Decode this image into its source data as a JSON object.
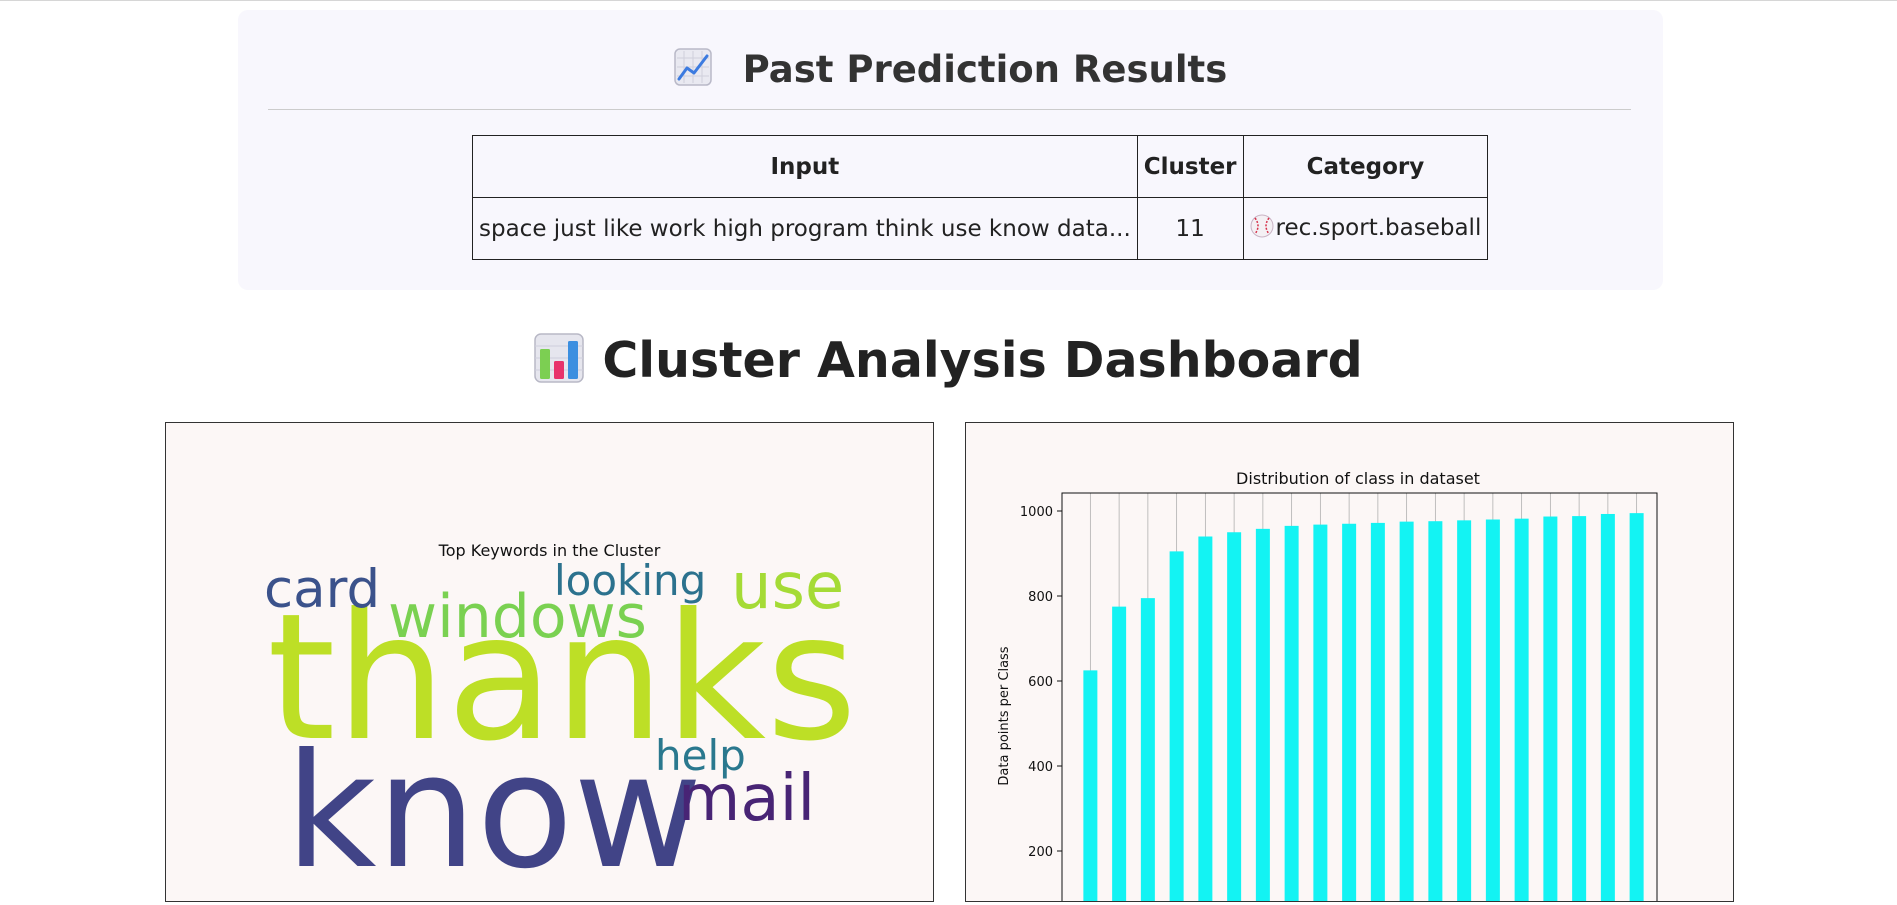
{
  "history": {
    "title": "Past Prediction Results",
    "title_icon": "chart-increasing-icon",
    "columns": [
      "Input",
      "Cluster",
      "Category"
    ],
    "rows": [
      {
        "input": "space just like work high program think use know data...",
        "cluster": "11",
        "category": "rec.sport.baseball",
        "category_icon": "baseball-icon"
      }
    ]
  },
  "dashboard": {
    "title": "Cluster Analysis Dashboard",
    "title_icon": "bar-chart-icon"
  },
  "wordcloud": {
    "title": "Top Keywords in the Cluster",
    "words": [
      {
        "text": "thanks",
        "color": "#bddf26"
      },
      {
        "text": "know",
        "color": "#414487"
      },
      {
        "text": "windows",
        "color": "#7ad151"
      },
      {
        "text": "use",
        "color": "#a5db36"
      },
      {
        "text": "card",
        "color": "#3b528b"
      },
      {
        "text": "looking",
        "color": "#2c728e"
      },
      {
        "text": "help",
        "color": "#2a788e"
      },
      {
        "text": "mail",
        "color": "#482475"
      }
    ]
  },
  "chart_data": {
    "type": "bar",
    "title": "Distribution of class in dataset",
    "ylabel": "Data points per Class",
    "xlabel": "",
    "ylim": [
      0,
      1040
    ],
    "yticks": [
      200,
      400,
      600,
      800,
      1000
    ],
    "color": "#13f3f3",
    "grid": "vertical",
    "values": [
      625,
      775,
      795,
      905,
      940,
      950,
      958,
      965,
      968,
      970,
      972,
      975,
      976,
      978,
      980,
      982,
      987,
      988,
      993,
      995
    ]
  }
}
